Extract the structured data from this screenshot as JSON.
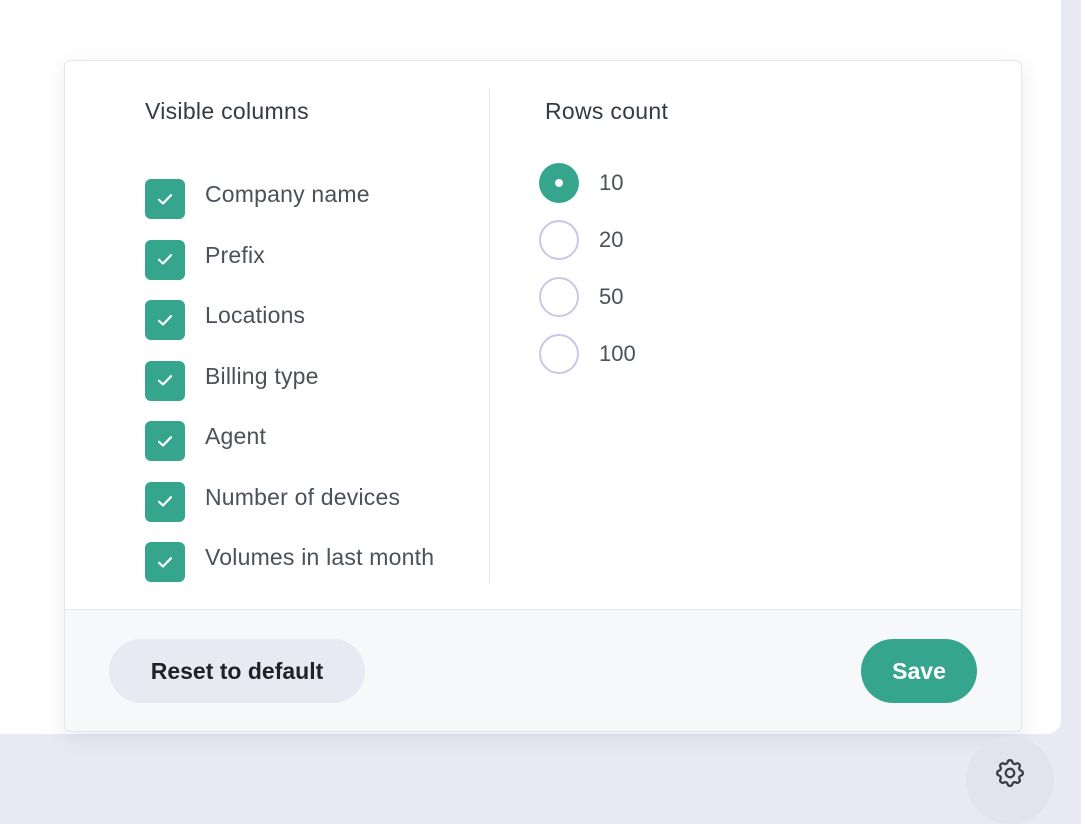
{
  "visible_columns": {
    "title": "Visible columns",
    "items": [
      {
        "label": "Company name",
        "checked": true
      },
      {
        "label": "Prefix",
        "checked": true
      },
      {
        "label": "Locations",
        "checked": true
      },
      {
        "label": "Billing type",
        "checked": true
      },
      {
        "label": "Agent",
        "checked": true
      },
      {
        "label": "Number of devices",
        "checked": true
      },
      {
        "label": "Volumes in last month",
        "checked": true
      }
    ]
  },
  "rows_count": {
    "title": "Rows count",
    "selected": "10",
    "options": [
      {
        "label": "10"
      },
      {
        "label": "20"
      },
      {
        "label": "50"
      },
      {
        "label": "100"
      }
    ]
  },
  "footer": {
    "reset_label": "Reset to default",
    "save_label": "Save"
  },
  "icons": {
    "checkbox": "check-icon",
    "settings": "gear-icon"
  },
  "colors": {
    "accent": "#35a58e",
    "radio_border": "#c9c7e3",
    "reset_bg": "#e9e9f4",
    "page_bg": "#e9e9f4",
    "text": "#4a5158"
  }
}
